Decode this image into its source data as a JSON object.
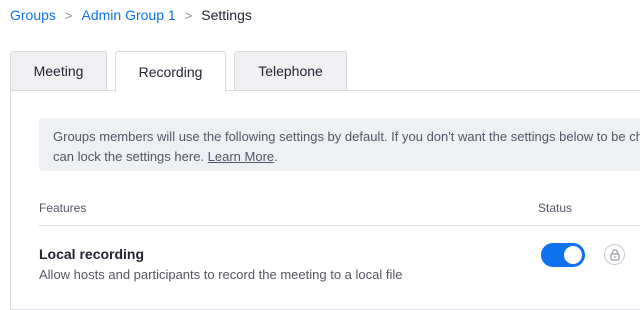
{
  "breadcrumb": {
    "items": [
      "Groups",
      "Admin Group 1"
    ],
    "separator": ">",
    "current": "Settings"
  },
  "tabs": [
    {
      "label": "Meeting",
      "active": false
    },
    {
      "label": "Recording",
      "active": true
    },
    {
      "label": "Telephone",
      "active": false
    }
  ],
  "notice": {
    "text": "Groups members will use the following settings by default. If you don't want the settings below to be changed, you",
    "text2": "can lock the settings here.",
    "link": "Learn More",
    "suffix": "."
  },
  "table": {
    "col_features": "Features",
    "col_status": "Status"
  },
  "setting": {
    "title": "Local recording",
    "description": "Allow hosts and participants to record the meeting to a local file",
    "enabled": true,
    "locked": false
  },
  "colors": {
    "accent": "#0e72ed",
    "notice_bg": "#eef0f4"
  },
  "icons": {
    "lock": "lock-icon"
  }
}
